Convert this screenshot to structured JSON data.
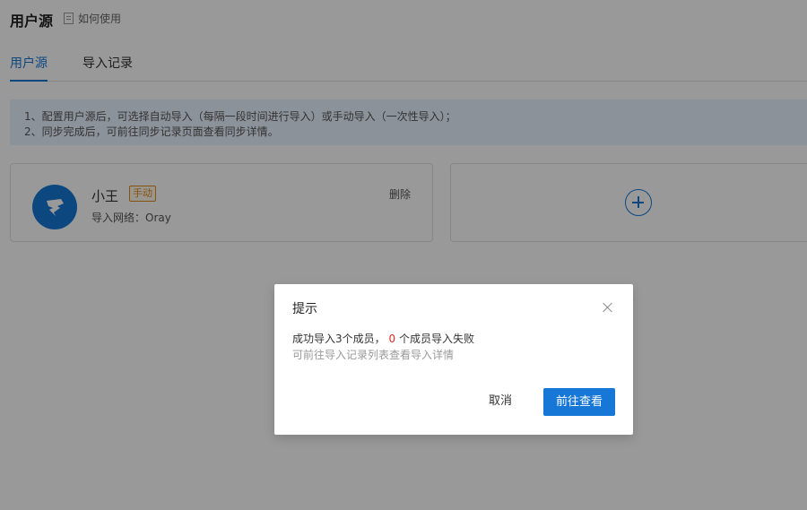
{
  "header": {
    "title": "用户源",
    "help_link": "如何使用"
  },
  "tabs": [
    {
      "label": "用户源",
      "active": true
    },
    {
      "label": "导入记录",
      "active": false
    }
  ],
  "notice": {
    "lines": [
      "1、配置用户源后，可选择自动导入（每隔一段时间进行导入）或手动导入（一次性导入）；",
      "2、同步完成后，可前往同步记录页面查看同步详情。"
    ]
  },
  "source_card": {
    "name": "小王",
    "mode_badge": "手动",
    "network": "导入网络：Oray",
    "delete_label": "删除"
  },
  "add_card": {
    "icon": "plus-circle-icon"
  },
  "modal": {
    "title": "提示",
    "result_prefix": "成功导入3个成员，",
    "fail_count": "0",
    "result_suffix": "个成员导入失败",
    "hint": "可前往导入记录列表查看导入详情",
    "cancel_label": "取消",
    "confirm_label": "前往查看"
  },
  "colors": {
    "accent": "#1677d6",
    "badge": "#e0891c",
    "error": "#e02a2a",
    "notice_bg": "#e8f3ff"
  }
}
